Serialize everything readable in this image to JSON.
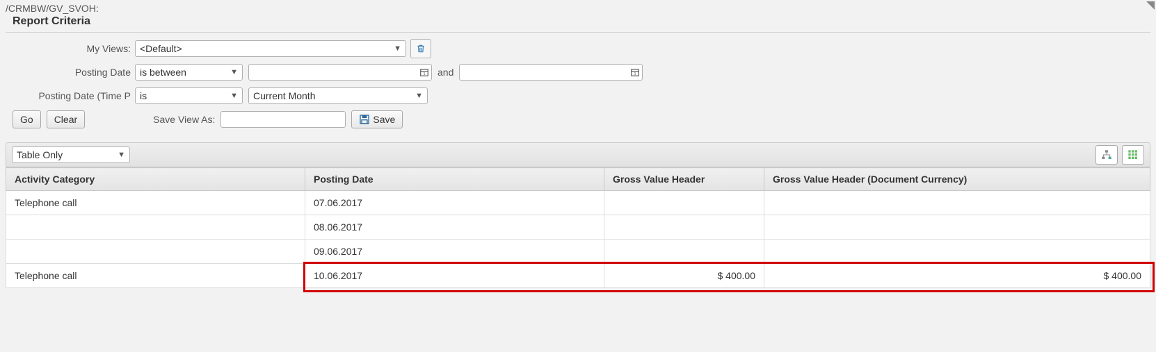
{
  "breadcrumb": "/CRMBW/GV_SVOH:",
  "page_title": "Report Criteria",
  "criteria": {
    "my_views_label": "My Views:",
    "my_views_value": "<Default>",
    "posting_date_label": "Posting Date",
    "posting_date_op": "is between",
    "and_label": "and",
    "posting_date_from": "",
    "posting_date_to": "",
    "posting_date_time_label": "Posting Date (Time P",
    "posting_date_time_op": "is",
    "posting_date_time_value": "Current Month"
  },
  "buttons": {
    "go": "Go",
    "clear": "Clear",
    "save_view_as_label": "Save View As:",
    "save_view_as_value": "",
    "save": "Save"
  },
  "results": {
    "view_mode": "Table Only",
    "columns": {
      "activity_category": "Activity Category",
      "posting_date": "Posting Date",
      "gross_value_header": "Gross Value Header",
      "gross_value_header_doc": "Gross Value Header (Document Currency)"
    },
    "rows": [
      {
        "activity_category": "Telephone call",
        "posting_date": "07.06.2017",
        "gross1": "",
        "gross2": ""
      },
      {
        "activity_category": "",
        "posting_date": "08.06.2017",
        "gross1": "",
        "gross2": ""
      },
      {
        "activity_category": "",
        "posting_date": "09.06.2017",
        "gross1": "",
        "gross2": ""
      },
      {
        "activity_category": "Telephone call",
        "posting_date": "10.06.2017",
        "gross1": "$ 400.00",
        "gross2": "$ 400.00"
      }
    ]
  }
}
